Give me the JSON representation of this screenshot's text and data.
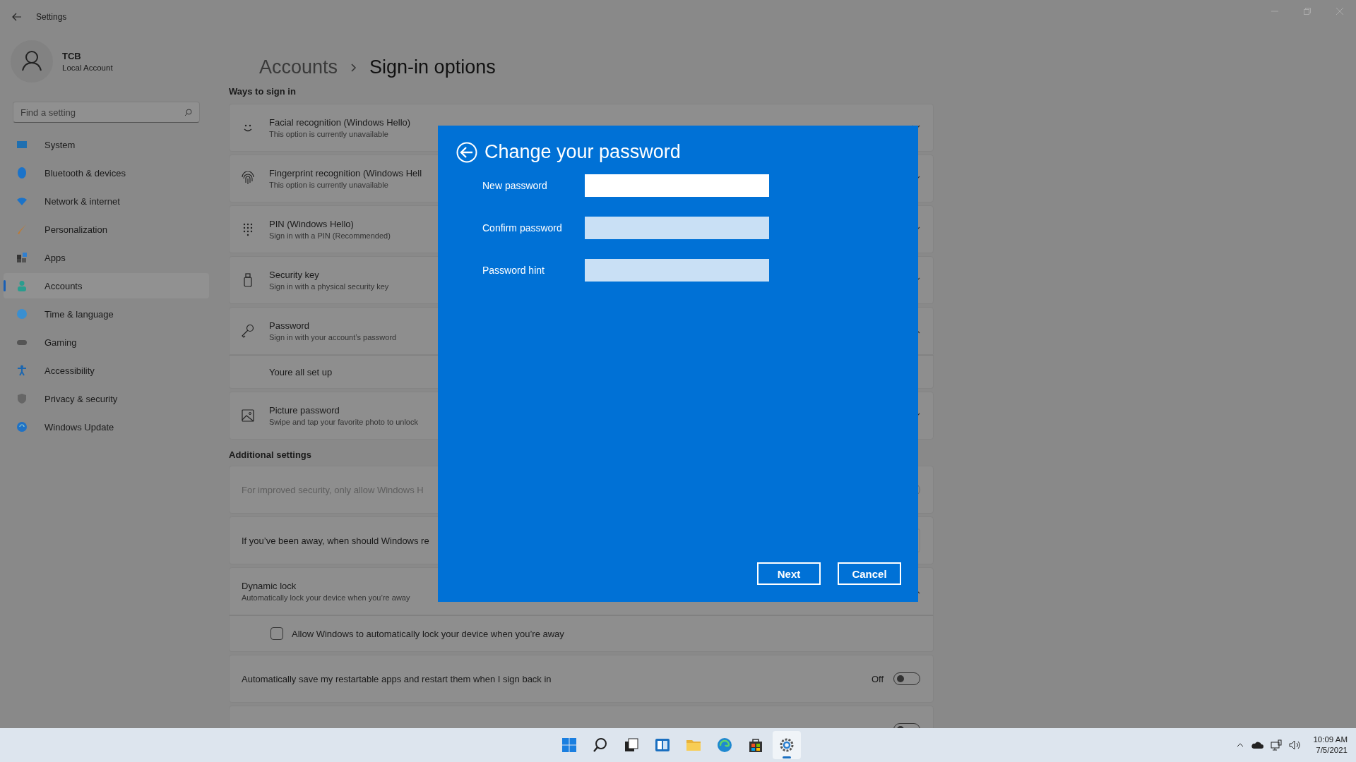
{
  "window": {
    "title": "Settings"
  },
  "account": {
    "name": "TCB",
    "type": "Local Account"
  },
  "search": {
    "placeholder": "Find a setting"
  },
  "nav": [
    {
      "label": "System",
      "selected": false
    },
    {
      "label": "Bluetooth & devices",
      "selected": false
    },
    {
      "label": "Network & internet",
      "selected": false
    },
    {
      "label": "Personalization",
      "selected": false
    },
    {
      "label": "Apps",
      "selected": false
    },
    {
      "label": "Accounts",
      "selected": true
    },
    {
      "label": "Time & language",
      "selected": false
    },
    {
      "label": "Gaming",
      "selected": false
    },
    {
      "label": "Accessibility",
      "selected": false
    },
    {
      "label": "Privacy & security",
      "selected": false
    },
    {
      "label": "Windows Update",
      "selected": false
    }
  ],
  "breadcrumb": {
    "parent": "Accounts",
    "current": "Sign-in options"
  },
  "ways_to_sign_in": {
    "heading": "Ways to sign in",
    "rows": [
      {
        "title": "Facial recognition (Windows Hello)",
        "subtitle": "This option is currently unavailable",
        "expanded": false
      },
      {
        "title": "Fingerprint recognition (Windows Hell",
        "subtitle": "This option is currently unavailable",
        "expanded": false
      },
      {
        "title": "PIN (Windows Hello)",
        "subtitle": "Sign in with a PIN (Recommended)",
        "expanded": false
      },
      {
        "title": "Security key",
        "subtitle": "Sign in with a physical security key",
        "expanded": false
      },
      {
        "title": "Password",
        "subtitle": "Sign in with your account’s password",
        "expanded": true,
        "detail": "Youre all set up"
      },
      {
        "title": "Picture password",
        "subtitle": "Swipe and tap your favorite photo to unlock",
        "expanded": false
      }
    ]
  },
  "additional_settings": {
    "heading": "Additional settings",
    "rows": [
      {
        "kind": "toggle",
        "title": "For improved security, only allow Windows H",
        "disabled": true,
        "on": false
      },
      {
        "kind": "dropdown",
        "title": "If you’ve been away, when should Windows re"
      },
      {
        "kind": "expander",
        "title": "Dynamic lock",
        "subtitle": "Automatically lock your device when you’re away",
        "expanded": true,
        "checkbox": {
          "label": "Allow Windows to automatically lock your device when you’re away",
          "checked": false
        }
      },
      {
        "kind": "toggle",
        "title": "Automatically save my restartable apps and restart them when I sign back in",
        "disabled": false,
        "on": false,
        "state_text": "Off"
      },
      {
        "kind": "toggle",
        "disabled": false,
        "on": false
      }
    ]
  },
  "dialog": {
    "title": "Change your password",
    "fields": [
      {
        "label": "New password",
        "focused": true
      },
      {
        "label": "Confirm password",
        "focused": false
      },
      {
        "label": "Password hint",
        "focused": false
      }
    ],
    "buttons": [
      "Next",
      "Cancel"
    ]
  },
  "taskbar": {
    "apps": [
      {
        "active": false
      },
      {
        "active": false
      },
      {
        "active": false
      },
      {
        "active": false
      },
      {
        "active": false
      },
      {
        "active": false
      },
      {
        "active": false
      },
      {
        "active": true
      }
    ],
    "time": "10:09 AM",
    "date": "7/5/2021"
  }
}
